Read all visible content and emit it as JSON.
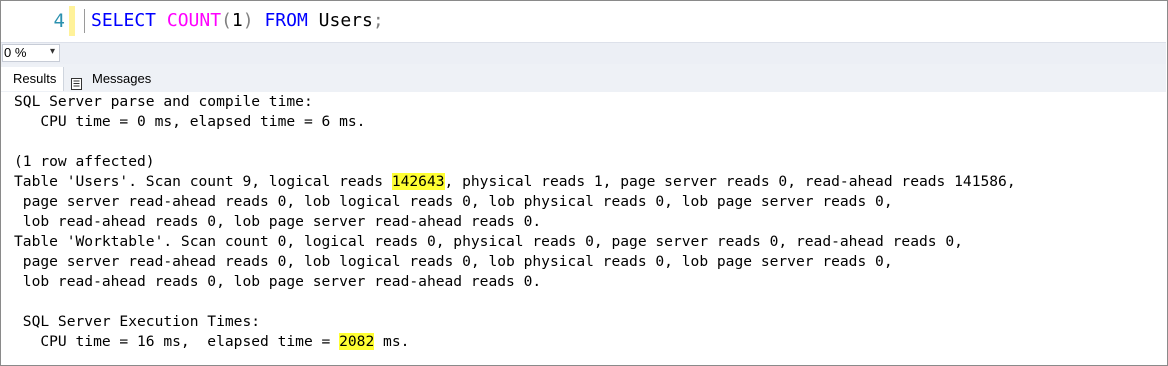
{
  "editor": {
    "line_number": "4",
    "code": {
      "select": "SELECT",
      "count": "COUNT",
      "open_paren": "(",
      "arg": "1",
      "close_paren": ")",
      "from": "FROM",
      "table": "Users",
      "semicolon": ";"
    }
  },
  "zoom": {
    "value": "0 %",
    "caret": "▾"
  },
  "tabs": {
    "results": "Results",
    "messages": "Messages"
  },
  "output": {
    "l1": "SQL Server parse and compile time:",
    "l2": "   CPU time = 0 ms, elapsed time = 6 ms.",
    "l3": "(1 row affected)",
    "l4_pre": "Table 'Users'. Scan count 9, logical reads ",
    "l4_hl": "142643",
    "l4_post": ", physical reads 1, page server reads 0, read-ahead reads 141586,",
    "l5": " page server read-ahead reads 0, lob logical reads 0, lob physical reads 0, lob page server reads 0,",
    "l6": " lob read-ahead reads 0, lob page server read-ahead reads 0.",
    "l7": "Table 'Worktable'. Scan count 0, logical reads 0, physical reads 0, page server reads 0, read-ahead reads 0,",
    "l8": " page server read-ahead reads 0, lob logical reads 0, lob physical reads 0, lob page server reads 0,",
    "l9": " lob read-ahead reads 0, lob page server read-ahead reads 0.",
    "l10": " SQL Server Execution Times:",
    "l11_pre": "   CPU time = 16 ms,  elapsed time = ",
    "l11_hl": "2082",
    "l11_post": " ms."
  },
  "colors": {
    "keyword": "#0000ff",
    "function": "#ff00ff",
    "line_number": "#2b91af",
    "highlight": "#ffff33"
  }
}
